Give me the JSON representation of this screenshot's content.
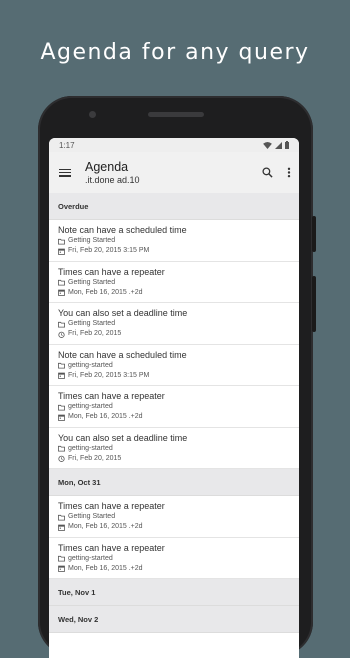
{
  "headline": "Agenda for any query",
  "status": {
    "time": "1:17"
  },
  "appbar": {
    "title": "Agenda",
    "subtitle": ".it.done ad.10"
  },
  "sections": [
    {
      "label": "Overdue",
      "items": [
        {
          "title": "Note can have a scheduled time",
          "book": "Getting Started",
          "date": "Fri, Feb 20, 2015 3:15 PM",
          "date_kind": "scheduled"
        },
        {
          "title": "Times can have a repeater",
          "book": "Getting Started",
          "date": "Mon, Feb 16, 2015 .+2d",
          "date_kind": "scheduled"
        },
        {
          "title": "You can also set a deadline time",
          "book": "Getting Started",
          "date": "Fri, Feb 20, 2015",
          "date_kind": "deadline"
        },
        {
          "title": "Note can have a scheduled time",
          "book": "getting-started",
          "date": "Fri, Feb 20, 2015 3:15 PM",
          "date_kind": "scheduled"
        },
        {
          "title": "Times can have a repeater",
          "book": "getting-started",
          "date": "Mon, Feb 16, 2015 .+2d",
          "date_kind": "scheduled"
        },
        {
          "title": "You can also set a deadline time",
          "book": "getting-started",
          "date": "Fri, Feb 20, 2015",
          "date_kind": "deadline"
        }
      ]
    },
    {
      "label": "Mon, Oct 31",
      "items": [
        {
          "title": "Times can have a repeater",
          "book": "Getting Started",
          "date": "Mon, Feb 16, 2015 .+2d",
          "date_kind": "scheduled"
        },
        {
          "title": "Times can have a repeater",
          "book": "getting-started",
          "date": "Mon, Feb 16, 2015 .+2d",
          "date_kind": "scheduled"
        }
      ]
    },
    {
      "label": "Tue, Nov 1",
      "items": []
    },
    {
      "label": "Wed, Nov 2",
      "items": []
    }
  ],
  "icons": {
    "menu": "menu-icon",
    "search": "search-icon",
    "overflow": "more-vert-icon",
    "book": "folder-icon",
    "scheduled": "calendar-icon",
    "deadline": "alarm-clock-icon"
  },
  "colors": {
    "background": "#566c73",
    "section_header": "#e8e8ea",
    "appbar": "#f1f1f1"
  }
}
